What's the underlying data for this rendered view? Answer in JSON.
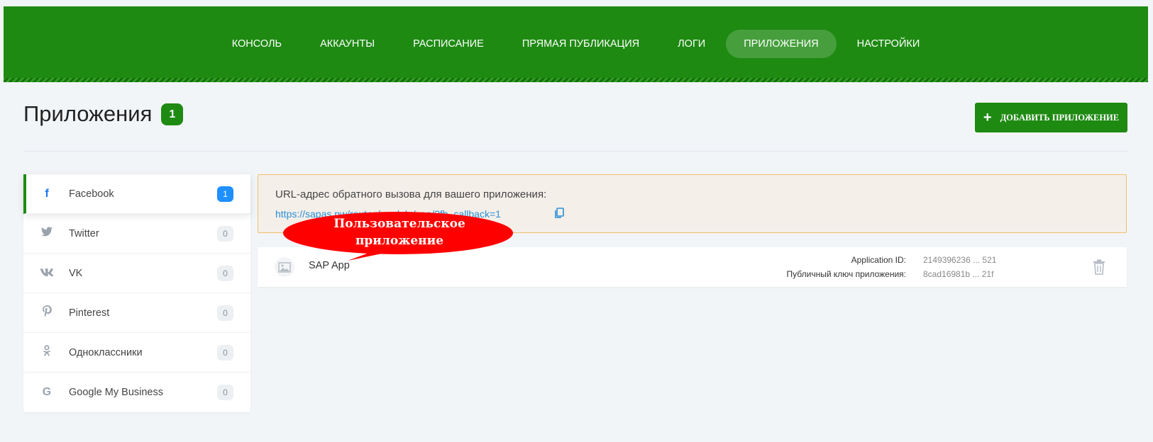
{
  "nav": {
    "items": [
      {
        "label": "Консоль",
        "active": false
      },
      {
        "label": "Аккаунты",
        "active": false
      },
      {
        "label": "Расписание",
        "active": false
      },
      {
        "label": "Прямая публикация",
        "active": false
      },
      {
        "label": "Логи",
        "active": false
      },
      {
        "label": "Приложения",
        "active": true
      },
      {
        "label": "Настройки",
        "active": false
      }
    ]
  },
  "header": {
    "title": "Приложения",
    "count": "1",
    "add_button": "ДОБАВИТЬ ПРИЛОЖЕНИЕ",
    "add_icon": "+"
  },
  "sidebar": {
    "items": [
      {
        "label": "Facebook",
        "count": "1",
        "icon": "facebook-icon",
        "glyph": "f",
        "active": true
      },
      {
        "label": "Twitter",
        "count": "0",
        "icon": "twitter-icon",
        "glyph": "🐦",
        "active": false
      },
      {
        "label": "VK",
        "count": "0",
        "icon": "vk-icon",
        "glyph": "vk",
        "active": false
      },
      {
        "label": "Pinterest",
        "count": "0",
        "icon": "pinterest-icon",
        "glyph": "P",
        "active": false
      },
      {
        "label": "Одноклассники",
        "count": "0",
        "icon": "odnoklassniki-icon",
        "glyph": "ok",
        "active": false
      },
      {
        "label": "Google My Business",
        "count": "0",
        "icon": "google-icon",
        "glyph": "G",
        "active": false
      }
    ]
  },
  "callback": {
    "text": "URL-адрес обратного вызова для вашего приложения:",
    "url": "https://sapas.pw/routes/module/sap/?fb_callback=1"
  },
  "annotation": {
    "line1": "Пользовательское",
    "line2": "приложение"
  },
  "app": {
    "name": "SAP App",
    "app_id_label": "Application ID:",
    "app_id_value": "2149396236 ... 521",
    "public_key_label": "Публичный ключ приложения:",
    "public_key_value": "8cad16981b ... 21f"
  },
  "colors": {
    "brand_green": "#1e8a12",
    "link_blue": "#2a8fd8",
    "badge_blue": "#1e90ff",
    "bubble_red": "#ff0000",
    "callback_border": "#f0c070"
  }
}
